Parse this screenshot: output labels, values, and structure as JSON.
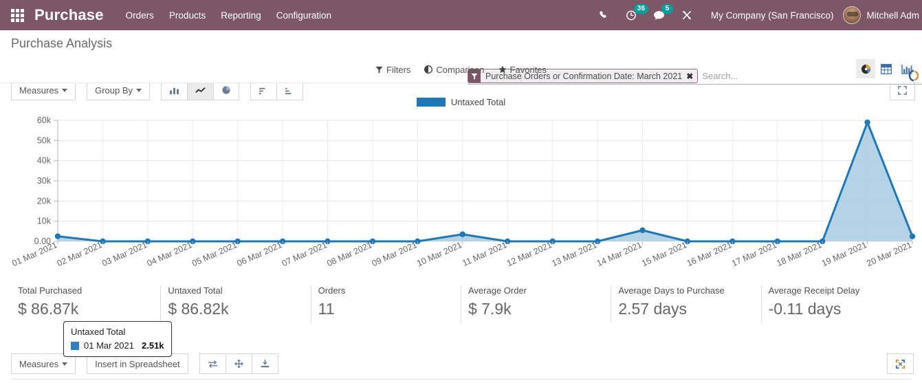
{
  "navbar": {
    "apps_icon": "apps-grid-icon",
    "brand": "Purchase",
    "menu": [
      {
        "label": "Orders"
      },
      {
        "label": "Products"
      },
      {
        "label": "Reporting"
      },
      {
        "label": "Configuration"
      }
    ],
    "phone_icon": "phone-icon",
    "activities": {
      "icon": "clock-icon",
      "count": "36"
    },
    "messages": {
      "icon": "chat-bubble-icon",
      "count": "5"
    },
    "debug_icon": "wrench-tools-icon",
    "company": "My Company (San Francisco)",
    "user": "Mitchell Adm"
  },
  "control_panel": {
    "title": "Purchase Analysis",
    "search": {
      "facet_icon": "filter-funnel-icon",
      "facet_label": "Purchase Orders or Confirmation Date: March 2021",
      "facet_remove_icon": "remove-facet-icon",
      "placeholder": "Search...",
      "value": "",
      "toggle_icon": "search-toggle-icon"
    },
    "dropdowns": [
      {
        "icon": "filter-icon",
        "label": "Filters"
      },
      {
        "icon": "comparison-icon",
        "label": "Comparison"
      },
      {
        "icon": "star-icon",
        "label": "Favorites"
      }
    ],
    "views": [
      {
        "name": "graph-view",
        "icon": "pie-graph-icon",
        "active": true
      },
      {
        "name": "pivot-view",
        "icon": "pivot-table-icon",
        "active": false
      },
      {
        "name": "list-chart-view",
        "icon": "bar-chart-icon",
        "active": false
      }
    ]
  },
  "graph_toolbar": {
    "measures_label": "Measures",
    "groupby_label": "Group By",
    "chart_types": [
      {
        "icon": "bar-chart-icon",
        "active": false
      },
      {
        "icon": "line-chart-icon",
        "active": true
      },
      {
        "icon": "pie-chart-icon",
        "active": false
      }
    ],
    "sorts": [
      {
        "icon": "sort-ascending-icon"
      },
      {
        "icon": "sort-descending-icon"
      }
    ],
    "expand_icon": "expand-icon"
  },
  "chart_legend": "Untaxed Total",
  "tooltip": {
    "title": "Untaxed Total",
    "label": "01 Mar 2021",
    "value": "2.51k"
  },
  "kpis": [
    {
      "label": "Total Purchased",
      "value": "$ 86.87k"
    },
    {
      "label": "Untaxed Total",
      "value": "$ 86.82k"
    },
    {
      "label": "Orders",
      "value": "11"
    },
    {
      "label": "Average Order",
      "value": "$ 7.9k"
    },
    {
      "label": "Average Days to Purchase",
      "value": "2.57 days"
    },
    {
      "label": "Average Receipt Delay",
      "value": "-0.11 days"
    }
  ],
  "bottom_toolbar": {
    "measures_label": "Measures",
    "spreadsheet_label": "Insert in Spreadsheet",
    "icons": [
      {
        "name": "flip-axis-icon"
      },
      {
        "name": "expand-all-icon"
      },
      {
        "name": "download-xlsx-icon"
      }
    ],
    "fullscreen_icon": "fullscreen-icon"
  },
  "chart_data": {
    "type": "area",
    "title": "",
    "xlabel": "",
    "ylabel": "",
    "legend_position": "top-center",
    "grid": true,
    "ylim": [
      0,
      60000
    ],
    "yticks": [
      "0.00",
      "10k",
      "20k",
      "30k",
      "40k",
      "50k",
      "60k"
    ],
    "ytick_values": [
      0,
      10000,
      20000,
      30000,
      40000,
      50000,
      60000
    ],
    "categories": [
      "01 Mar 2021",
      "02 Mar 2021",
      "03 Mar 2021",
      "04 Mar 2021",
      "05 Mar 2021",
      "06 Mar 2021",
      "07 Mar 2021",
      "08 Mar 2021",
      "09 Mar 2021",
      "10 Mar 2021",
      "11 Mar 2021",
      "12 Mar 2021",
      "13 Mar 2021",
      "14 Mar 2021",
      "15 Mar 2021",
      "16 Mar 2021",
      "17 Mar 2021",
      "18 Mar 2021",
      "19 Mar 2021",
      "20 Mar 2021"
    ],
    "series": [
      {
        "name": "Untaxed Total",
        "color": "#1f77b4",
        "fill": "#a8cbe2",
        "values": [
          2510,
          0,
          0,
          0,
          0,
          0,
          0,
          0,
          0,
          3500,
          0,
          0,
          0,
          5500,
          0,
          0,
          0,
          0,
          59000,
          2500
        ]
      }
    ]
  }
}
